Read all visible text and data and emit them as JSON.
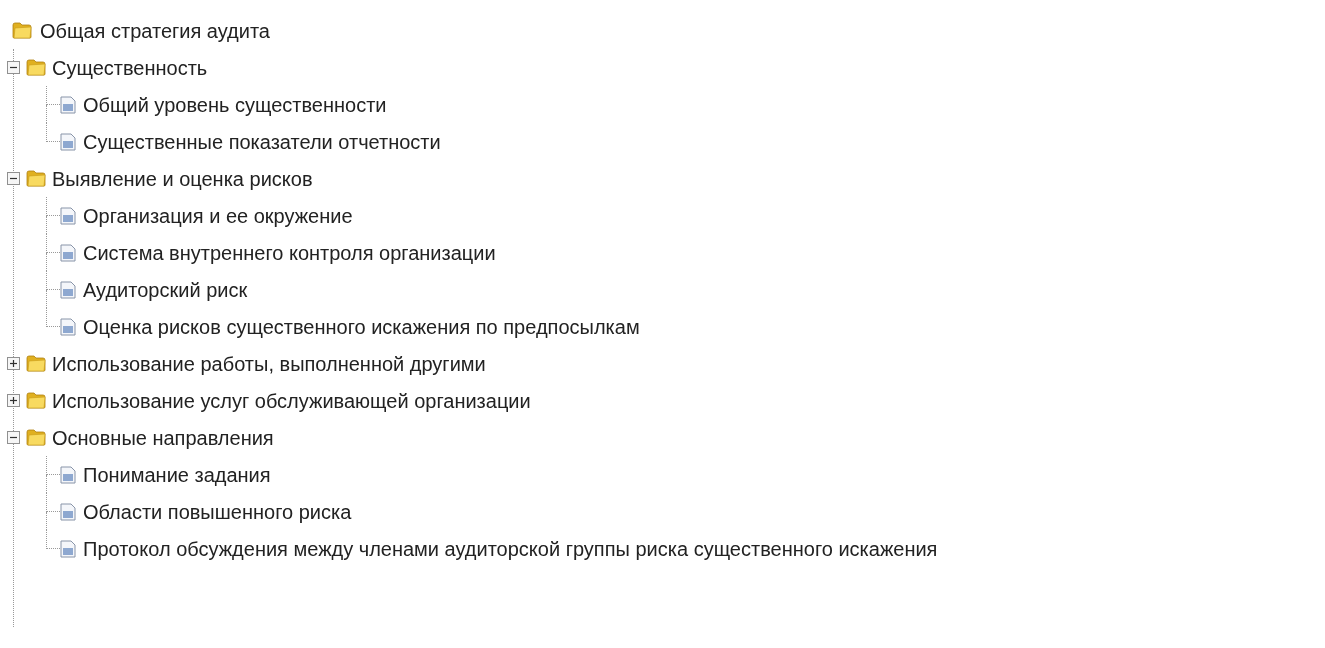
{
  "tree": {
    "label": "Общая стратегия аудита",
    "children": [
      {
        "kind": "folder",
        "label": "Существенность",
        "expanded": true,
        "children": [
          {
            "kind": "document",
            "label": "Общий уровень существенности"
          },
          {
            "kind": "document",
            "label": "Существенные показатели отчетности"
          }
        ]
      },
      {
        "kind": "folder",
        "label": "Выявление и оценка рисков",
        "expanded": true,
        "children": [
          {
            "kind": "document",
            "label": "Организация и ее окружение"
          },
          {
            "kind": "document",
            "label": "Система внутреннего контроля организации"
          },
          {
            "kind": "document",
            "label": "Аудиторский риск"
          },
          {
            "kind": "document",
            "label": "Оценка рисков существенного искажения по предпосылкам"
          }
        ]
      },
      {
        "kind": "folder",
        "label": "Использование работы, выполненной другими",
        "expanded": false
      },
      {
        "kind": "folder",
        "label": "Использование услуг обслуживающей организации",
        "expanded": false
      },
      {
        "kind": "folder",
        "label": "Основные направления",
        "expanded": true,
        "children": [
          {
            "kind": "document",
            "label": "Понимание задания"
          },
          {
            "kind": "document",
            "label": "Области повышенного риска"
          },
          {
            "kind": "document",
            "label": "Протокол обсуждения между членами аудиторской группы риска существенного искажения"
          }
        ]
      }
    ]
  }
}
